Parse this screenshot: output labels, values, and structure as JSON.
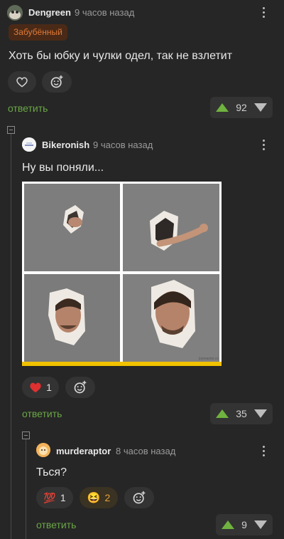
{
  "comments": [
    {
      "author": "Dengreen",
      "time": "9 часов назад",
      "badge": "Забубённый",
      "text": "Хоть бы юбку и чулки одел, так не взлетит",
      "reply_label": "ответить",
      "rating": "92",
      "reaction_icons": [
        "heart-outline-icon",
        "add-emoji-icon"
      ]
    },
    {
      "author": "Bikeronish",
      "time": "9 часов назад",
      "text": "Ну вы поняли...",
      "image_watermark": "joyreactor.cc",
      "reactions": [
        {
          "icon": "red-heart-icon",
          "count": "1"
        }
      ],
      "reply_label": "ответить",
      "rating": "35"
    },
    {
      "author": "murderaptor",
      "time": "8 часов назад",
      "text": "Ться?",
      "reactions": [
        {
          "icon": "hundred-points-icon",
          "emoji": "💯",
          "count": "1"
        },
        {
          "icon": "laughing-face-icon",
          "emoji": "😆",
          "count": "2"
        }
      ],
      "reply_label": "ответить",
      "rating": "9"
    }
  ],
  "colors": {
    "background": "#262626",
    "pill": "#333333",
    "reply_green": "#69a745",
    "upvote_green": "#6fb23f",
    "badge_bg": "#4a2a17",
    "badge_text": "#e07a3a"
  }
}
